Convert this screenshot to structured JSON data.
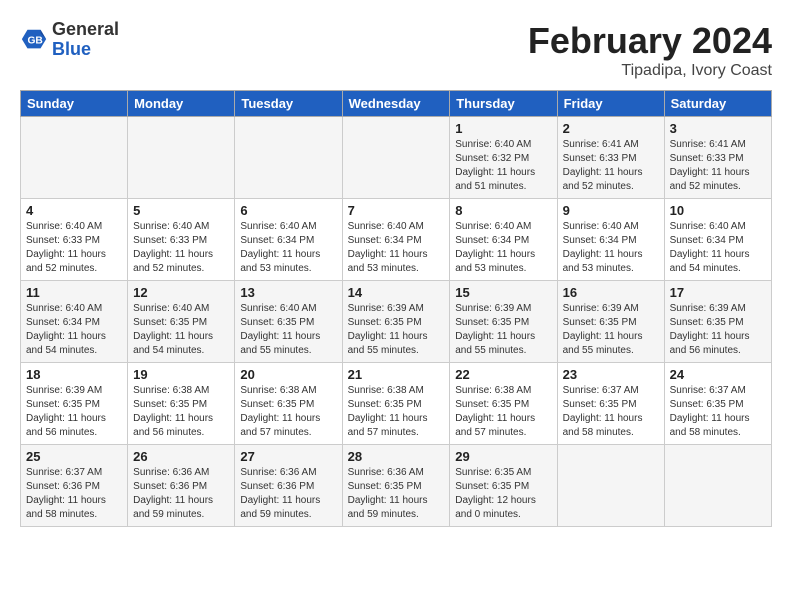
{
  "header": {
    "logo_line1": "General",
    "logo_line2": "Blue",
    "month": "February 2024",
    "location": "Tipadipa, Ivory Coast"
  },
  "weekdays": [
    "Sunday",
    "Monday",
    "Tuesday",
    "Wednesday",
    "Thursday",
    "Friday",
    "Saturday"
  ],
  "weeks": [
    [
      {
        "day": "",
        "info": ""
      },
      {
        "day": "",
        "info": ""
      },
      {
        "day": "",
        "info": ""
      },
      {
        "day": "",
        "info": ""
      },
      {
        "day": "1",
        "info": "Sunrise: 6:40 AM\nSunset: 6:32 PM\nDaylight: 11 hours\nand 51 minutes."
      },
      {
        "day": "2",
        "info": "Sunrise: 6:41 AM\nSunset: 6:33 PM\nDaylight: 11 hours\nand 52 minutes."
      },
      {
        "day": "3",
        "info": "Sunrise: 6:41 AM\nSunset: 6:33 PM\nDaylight: 11 hours\nand 52 minutes."
      }
    ],
    [
      {
        "day": "4",
        "info": "Sunrise: 6:40 AM\nSunset: 6:33 PM\nDaylight: 11 hours\nand 52 minutes."
      },
      {
        "day": "5",
        "info": "Sunrise: 6:40 AM\nSunset: 6:33 PM\nDaylight: 11 hours\nand 52 minutes."
      },
      {
        "day": "6",
        "info": "Sunrise: 6:40 AM\nSunset: 6:34 PM\nDaylight: 11 hours\nand 53 minutes."
      },
      {
        "day": "7",
        "info": "Sunrise: 6:40 AM\nSunset: 6:34 PM\nDaylight: 11 hours\nand 53 minutes."
      },
      {
        "day": "8",
        "info": "Sunrise: 6:40 AM\nSunset: 6:34 PM\nDaylight: 11 hours\nand 53 minutes."
      },
      {
        "day": "9",
        "info": "Sunrise: 6:40 AM\nSunset: 6:34 PM\nDaylight: 11 hours\nand 53 minutes."
      },
      {
        "day": "10",
        "info": "Sunrise: 6:40 AM\nSunset: 6:34 PM\nDaylight: 11 hours\nand 54 minutes."
      }
    ],
    [
      {
        "day": "11",
        "info": "Sunrise: 6:40 AM\nSunset: 6:34 PM\nDaylight: 11 hours\nand 54 minutes."
      },
      {
        "day": "12",
        "info": "Sunrise: 6:40 AM\nSunset: 6:35 PM\nDaylight: 11 hours\nand 54 minutes."
      },
      {
        "day": "13",
        "info": "Sunrise: 6:40 AM\nSunset: 6:35 PM\nDaylight: 11 hours\nand 55 minutes."
      },
      {
        "day": "14",
        "info": "Sunrise: 6:39 AM\nSunset: 6:35 PM\nDaylight: 11 hours\nand 55 minutes."
      },
      {
        "day": "15",
        "info": "Sunrise: 6:39 AM\nSunset: 6:35 PM\nDaylight: 11 hours\nand 55 minutes."
      },
      {
        "day": "16",
        "info": "Sunrise: 6:39 AM\nSunset: 6:35 PM\nDaylight: 11 hours\nand 55 minutes."
      },
      {
        "day": "17",
        "info": "Sunrise: 6:39 AM\nSunset: 6:35 PM\nDaylight: 11 hours\nand 56 minutes."
      }
    ],
    [
      {
        "day": "18",
        "info": "Sunrise: 6:39 AM\nSunset: 6:35 PM\nDaylight: 11 hours\nand 56 minutes."
      },
      {
        "day": "19",
        "info": "Sunrise: 6:38 AM\nSunset: 6:35 PM\nDaylight: 11 hours\nand 56 minutes."
      },
      {
        "day": "20",
        "info": "Sunrise: 6:38 AM\nSunset: 6:35 PM\nDaylight: 11 hours\nand 57 minutes."
      },
      {
        "day": "21",
        "info": "Sunrise: 6:38 AM\nSunset: 6:35 PM\nDaylight: 11 hours\nand 57 minutes."
      },
      {
        "day": "22",
        "info": "Sunrise: 6:38 AM\nSunset: 6:35 PM\nDaylight: 11 hours\nand 57 minutes."
      },
      {
        "day": "23",
        "info": "Sunrise: 6:37 AM\nSunset: 6:35 PM\nDaylight: 11 hours\nand 58 minutes."
      },
      {
        "day": "24",
        "info": "Sunrise: 6:37 AM\nSunset: 6:35 PM\nDaylight: 11 hours\nand 58 minutes."
      }
    ],
    [
      {
        "day": "25",
        "info": "Sunrise: 6:37 AM\nSunset: 6:36 PM\nDaylight: 11 hours\nand 58 minutes."
      },
      {
        "day": "26",
        "info": "Sunrise: 6:36 AM\nSunset: 6:36 PM\nDaylight: 11 hours\nand 59 minutes."
      },
      {
        "day": "27",
        "info": "Sunrise: 6:36 AM\nSunset: 6:36 PM\nDaylight: 11 hours\nand 59 minutes."
      },
      {
        "day": "28",
        "info": "Sunrise: 6:36 AM\nSunset: 6:35 PM\nDaylight: 11 hours\nand 59 minutes."
      },
      {
        "day": "29",
        "info": "Sunrise: 6:35 AM\nSunset: 6:35 PM\nDaylight: 12 hours\nand 0 minutes."
      },
      {
        "day": "",
        "info": ""
      },
      {
        "day": "",
        "info": ""
      }
    ]
  ]
}
